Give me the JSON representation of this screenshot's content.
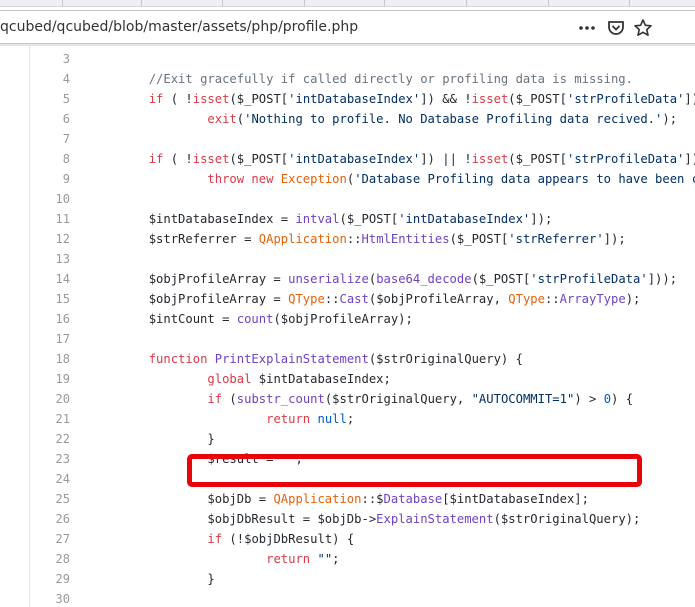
{
  "url": "qcubed/qcubed/blob/master/assets/php/profile.php",
  "icons": {
    "more": "more-icon",
    "pocket": "pocket-icon",
    "bookmark": "star-icon"
  },
  "code_lines": [
    {
      "n": "3",
      "segs": []
    },
    {
      "n": "4",
      "segs": [
        {
          "t": "        "
        },
        {
          "t": "//Exit gracefully if called directly or profiling data is missing.",
          "c": "cm"
        }
      ]
    },
    {
      "n": "5",
      "segs": [
        {
          "t": "        "
        },
        {
          "t": "if",
          "c": "kw"
        },
        {
          "t": " ( !"
        },
        {
          "t": "isset",
          "c": "kw"
        },
        {
          "t": "($_POST["
        },
        {
          "t": "'intDatabaseIndex'",
          "c": "str"
        },
        {
          "t": "]) && !"
        },
        {
          "t": "isset",
          "c": "kw"
        },
        {
          "t": "($_POST["
        },
        {
          "t": "'strProfileData'",
          "c": "str"
        },
        {
          "t": "])"
        }
      ]
    },
    {
      "n": "6",
      "segs": [
        {
          "t": "                "
        },
        {
          "t": "exit",
          "c": "kw"
        },
        {
          "t": "("
        },
        {
          "t": "'Nothing to profile. No Database Profiling data recived.'",
          "c": "str"
        },
        {
          "t": ");"
        }
      ]
    },
    {
      "n": "7",
      "segs": []
    },
    {
      "n": "8",
      "segs": [
        {
          "t": "        "
        },
        {
          "t": "if",
          "c": "kw"
        },
        {
          "t": " ( !"
        },
        {
          "t": "isset",
          "c": "kw"
        },
        {
          "t": "($_POST["
        },
        {
          "t": "'intDatabaseIndex'",
          "c": "str"
        },
        {
          "t": "]) || !"
        },
        {
          "t": "isset",
          "c": "kw"
        },
        {
          "t": "($_POST["
        },
        {
          "t": "'strProfileData'",
          "c": "str"
        },
        {
          "t": "])"
        }
      ]
    },
    {
      "n": "9",
      "segs": [
        {
          "t": "                "
        },
        {
          "t": "throw new",
          "c": "kw"
        },
        {
          "t": " "
        },
        {
          "t": "Exception",
          "c": "cls"
        },
        {
          "t": "("
        },
        {
          "t": "'Database Profiling data appears to have been co",
          "c": "str"
        }
      ]
    },
    {
      "n": "10",
      "segs": []
    },
    {
      "n": "11",
      "segs": [
        {
          "t": "        $intDatabaseIndex = "
        },
        {
          "t": "intval",
          "c": "fn"
        },
        {
          "t": "($_POST["
        },
        {
          "t": "'intDatabaseIndex'",
          "c": "str"
        },
        {
          "t": "]);"
        }
      ]
    },
    {
      "n": "12",
      "segs": [
        {
          "t": "        $strReferrer = "
        },
        {
          "t": "QApplication",
          "c": "cls"
        },
        {
          "t": "::"
        },
        {
          "t": "HtmlEntities",
          "c": "fn"
        },
        {
          "t": "($_POST["
        },
        {
          "t": "'strReferrer'",
          "c": "str"
        },
        {
          "t": "]);"
        }
      ]
    },
    {
      "n": "13",
      "segs": []
    },
    {
      "n": "14",
      "segs": [
        {
          "t": "        $objProfileArray = "
        },
        {
          "t": "unserialize",
          "c": "fn"
        },
        {
          "t": "("
        },
        {
          "t": "base64_decode",
          "c": "fn"
        },
        {
          "t": "($_POST["
        },
        {
          "t": "'strProfileData'",
          "c": "str"
        },
        {
          "t": "]));"
        }
      ]
    },
    {
      "n": "15",
      "segs": [
        {
          "t": "        $objProfileArray = "
        },
        {
          "t": "QType",
          "c": "cls"
        },
        {
          "t": "::"
        },
        {
          "t": "Cast",
          "c": "fn"
        },
        {
          "t": "($objProfileArray, "
        },
        {
          "t": "QType",
          "c": "cls"
        },
        {
          "t": "::"
        },
        {
          "t": "ArrayType",
          "c": "fn"
        },
        {
          "t": ");"
        }
      ]
    },
    {
      "n": "16",
      "segs": [
        {
          "t": "        $intCount = "
        },
        {
          "t": "count",
          "c": "fn"
        },
        {
          "t": "($objProfileArray);"
        }
      ]
    },
    {
      "n": "17",
      "segs": []
    },
    {
      "n": "18",
      "segs": [
        {
          "t": "        "
        },
        {
          "t": "function",
          "c": "kw"
        },
        {
          "t": " "
        },
        {
          "t": "PrintExplainStatement",
          "c": "fn"
        },
        {
          "t": "($strOriginalQuery) {"
        }
      ]
    },
    {
      "n": "19",
      "segs": [
        {
          "t": "                "
        },
        {
          "t": "global",
          "c": "kw"
        },
        {
          "t": " $intDatabaseIndex;"
        }
      ]
    },
    {
      "n": "20",
      "segs": [
        {
          "t": "                "
        },
        {
          "t": "if",
          "c": "kw"
        },
        {
          "t": " ("
        },
        {
          "t": "substr_count",
          "c": "fn"
        },
        {
          "t": "($strOriginalQuery, "
        },
        {
          "t": "\"AUTOCOMMIT=1\"",
          "c": "str"
        },
        {
          "t": ") > "
        },
        {
          "t": "0",
          "c": "num"
        },
        {
          "t": ") {"
        }
      ]
    },
    {
      "n": "21",
      "segs": [
        {
          "t": "                        "
        },
        {
          "t": "return",
          "c": "kw"
        },
        {
          "t": " "
        },
        {
          "t": "null",
          "c": "num"
        },
        {
          "t": ";"
        }
      ]
    },
    {
      "n": "22",
      "segs": [
        {
          "t": "                }"
        }
      ]
    },
    {
      "n": "23",
      "segs": [
        {
          "t": "                $result = "
        },
        {
          "t": "\"\"",
          "c": "str"
        },
        {
          "t": ";"
        }
      ]
    },
    {
      "n": "24",
      "segs": []
    },
    {
      "n": "25",
      "segs": [
        {
          "t": "                $objDb = "
        },
        {
          "t": "QApplication",
          "c": "cls"
        },
        {
          "t": "::$"
        },
        {
          "t": "Database",
          "c": "fn"
        },
        {
          "t": "[$intDatabaseIndex];"
        }
      ]
    },
    {
      "n": "26",
      "segs": [
        {
          "t": "                $objDbResult = $objDb->"
        },
        {
          "t": "ExplainStatement",
          "c": "fn"
        },
        {
          "t": "($strOriginalQuery);"
        }
      ]
    },
    {
      "n": "27",
      "segs": [
        {
          "t": "                "
        },
        {
          "t": "if",
          "c": "kw"
        },
        {
          "t": " (!$objDbResult) {"
        }
      ]
    },
    {
      "n": "28",
      "segs": [
        {
          "t": "                        "
        },
        {
          "t": "return",
          "c": "kw"
        },
        {
          "t": " "
        },
        {
          "t": "\"\"",
          "c": "str"
        },
        {
          "t": ";"
        }
      ]
    },
    {
      "n": "29",
      "segs": [
        {
          "t": "                }"
        }
      ]
    },
    {
      "n": "30",
      "segs": []
    }
  ],
  "colors": {
    "highlight": "#e5050b"
  }
}
